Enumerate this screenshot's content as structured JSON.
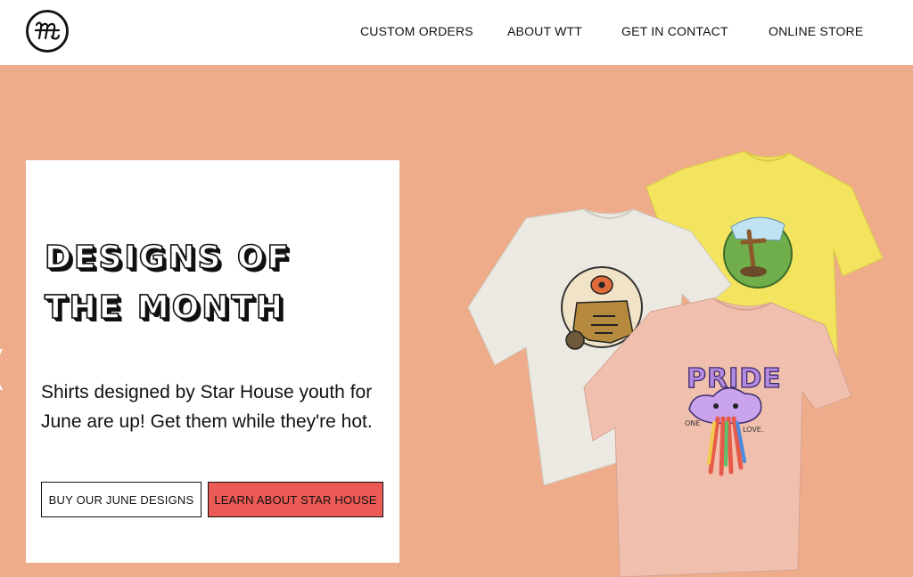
{
  "header": {
    "logo_alt": "WTT",
    "nav": [
      {
        "label": "CUSTOM ORDERS"
      },
      {
        "label": "ABOUT WTT"
      },
      {
        "label": "GET IN CONTACT"
      },
      {
        "label": "ONLINE STORE"
      }
    ]
  },
  "hero": {
    "title_line1": "DESIGNS OF",
    "title_line2": "THE MONTH",
    "description": "Shirts designed by Star House youth for June are up! Get them while they're hot.",
    "buttons": {
      "primary_label": "BUY OUR JUNE DESIGNS",
      "secondary_label": "LEARN ABOUT STAR HOUSE"
    },
    "slider_prev_icon": "chevron-left-icon"
  },
  "products": {
    "pride_text": "PRIDE",
    "one_text": "ONE",
    "love_text": "LOVE."
  },
  "colors": {
    "hero_background": "#eeac8a",
    "accent_button": "#ec5a55",
    "shirt_white": "#ece9e2",
    "shirt_yellow": "#f2e45e",
    "shirt_pink": "#f0bfae"
  }
}
